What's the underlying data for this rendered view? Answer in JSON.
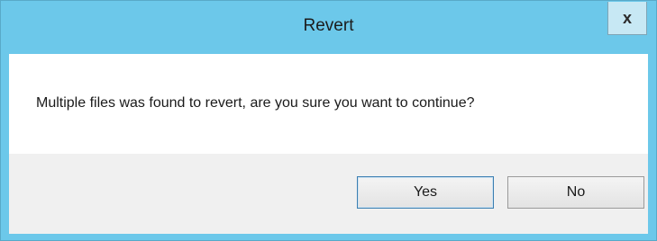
{
  "window": {
    "title": "Revert",
    "close_glyph": "x",
    "close_icon": "close-icon"
  },
  "dialog": {
    "message": "Multiple files was found to revert, are you sure you want to continue?",
    "yes_label": "Yes",
    "no_label": "No",
    "default_button": "yes"
  },
  "colors": {
    "titlebar": "#6cc8ea",
    "client_background": "#f0f0f0",
    "message_background": "#ffffff",
    "default_button_border": "#3c7fb1"
  }
}
